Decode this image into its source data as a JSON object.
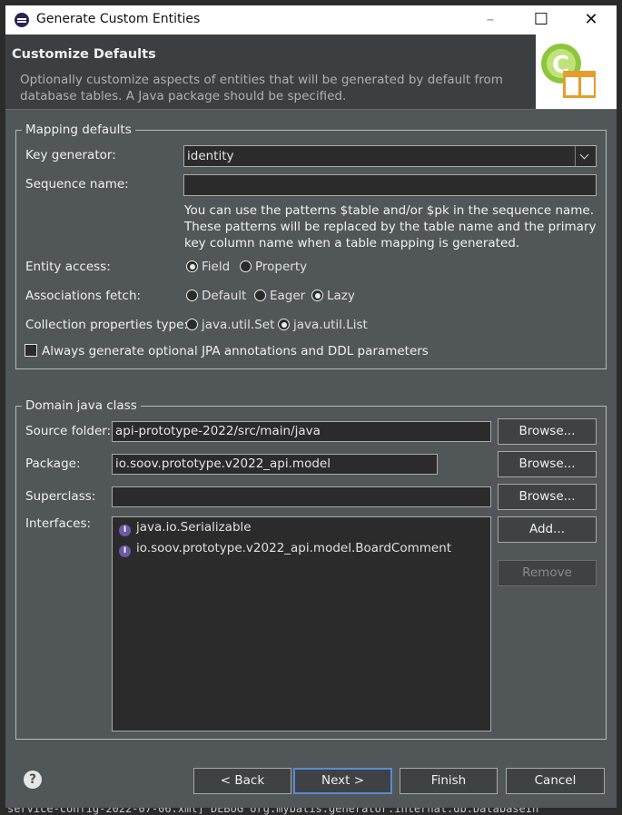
{
  "window": {
    "title": "Generate Custom Entities"
  },
  "banner": {
    "title": "Customize Defaults",
    "description": "Optionally customize aspects of entities that will be generated by default from database tables. A Java package should be specified."
  },
  "mapping": {
    "legend": "Mapping defaults",
    "key_generator_label": "Key generator:",
    "key_generator_value": "identity",
    "sequence_label": "Sequence name:",
    "sequence_value": "",
    "help_text": "You can use the patterns $table and/or $pk in the sequence name. These patterns will be replaced by the table name and the primary key column name when a table mapping is generated.",
    "entity_access_label": "Entity access:",
    "entity_access_options": [
      "Field",
      "Property"
    ],
    "entity_access_selected": "Field",
    "assoc_fetch_label": "Associations fetch:",
    "assoc_fetch_options": [
      "Default",
      "Eager",
      "Lazy"
    ],
    "assoc_fetch_selected": "Lazy",
    "collection_label": "Collection properties type:",
    "collection_options": [
      "java.util.Set",
      "java.util.List"
    ],
    "collection_selected": "java.util.List",
    "always_generate_label": "Always generate optional JPA annotations and DDL parameters",
    "always_generate_checked": false
  },
  "domain": {
    "legend": "Domain java class",
    "source_folder_label": "Source folder:",
    "source_folder_value": "api-prototype-2022/src/main/java",
    "package_label": "Package:",
    "package_value": "io.soov.prototype.v2022_api.model",
    "superclass_label": "Superclass:",
    "superclass_value": "",
    "interfaces_label": "Interfaces:",
    "interfaces": [
      "java.io.Serializable",
      "io.soov.prototype.v2022_api.model.BoardComment"
    ],
    "browse_label": "Browse...",
    "add_label": "Add...",
    "remove_label": "Remove"
  },
  "footer": {
    "back_label": "< Back",
    "next_label": "Next >",
    "finish_label": "Finish",
    "cancel_label": "Cancel"
  },
  "background": {
    "console_line": "service-config-2022-07-06.xml] DEBUG org.mybatis.generator.internal.db.DatabaseIn"
  }
}
